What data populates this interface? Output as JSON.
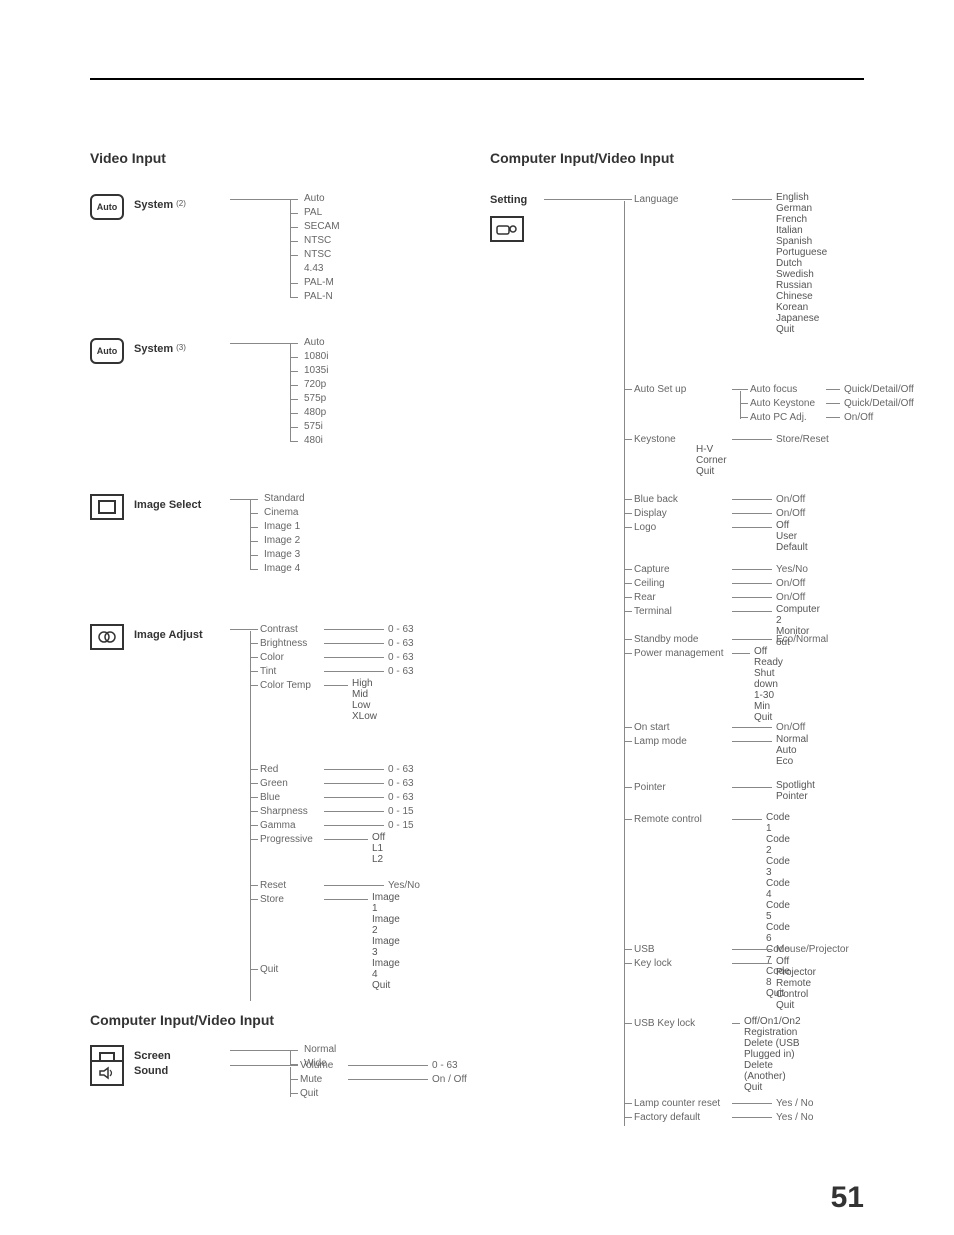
{
  "page_number": "51",
  "video_input": {
    "title": "Video Input",
    "auto_label": "Auto",
    "system2": {
      "label": "System",
      "note": "(2)",
      "items": [
        "Auto",
        "PAL",
        "SECAM",
        "NTSC",
        "NTSC 4.43",
        "PAL-M",
        "PAL-N"
      ]
    },
    "system3": {
      "label": "System",
      "note": "(3)",
      "items": [
        "Auto",
        "1080i",
        "1035i",
        "720p",
        "575p",
        "480p",
        "575i",
        "480i"
      ]
    },
    "image_select": {
      "label": "Image Select",
      "items": [
        "Standard",
        "Cinema",
        "Image 1",
        "Image 2",
        "Image 3",
        "Image 4"
      ]
    },
    "image_adjust": {
      "label": "Image Adjust",
      "pairs1": [
        {
          "k": "Contrast",
          "v": "0 - 63"
        },
        {
          "k": "Brightness",
          "v": "0 - 63"
        },
        {
          "k": "Color",
          "v": "0 - 63"
        },
        {
          "k": "Tint",
          "v": "0 - 63"
        }
      ],
      "color_temp": {
        "k": "Color Temp",
        "items": [
          "High",
          "Mid",
          "Low",
          "XLow"
        ]
      },
      "pairs2": [
        {
          "k": "Red",
          "v": "0 - 63"
        },
        {
          "k": "Green",
          "v": "0 - 63"
        },
        {
          "k": "Blue",
          "v": "0 - 63"
        },
        {
          "k": "Sharpness",
          "v": "0 - 15"
        },
        {
          "k": "Gamma",
          "v": "0 - 15"
        }
      ],
      "progressive": {
        "k": "Progressive",
        "items": [
          "Off",
          "L1",
          "L2"
        ]
      },
      "reset": {
        "k": "Reset",
        "v": "Yes/No"
      },
      "store": {
        "k": "Store",
        "items": [
          "Image 1",
          "Image 2",
          "Image 3",
          "Image 4",
          "Quit"
        ]
      },
      "quit": "Quit"
    },
    "screen": {
      "label": "Screen",
      "items": [
        "Normal",
        "Wide"
      ]
    }
  },
  "sound": {
    "title": "Computer Input/Video Input",
    "label": "Sound",
    "volume": {
      "k": "Volume",
      "v": "0 - 63"
    },
    "mute": {
      "k": "Mute",
      "v": "On / Off"
    },
    "quit": "Quit"
  },
  "setting": {
    "title": "Computer Input/Video Input",
    "label": "Setting",
    "language": {
      "k": "Language",
      "items": [
        "English",
        "German",
        "French",
        "Italian",
        "Spanish",
        "Portuguese",
        "Dutch",
        "Swedish",
        "Russian",
        "Chinese",
        "Korean",
        "Japanese",
        "Quit"
      ]
    },
    "auto_setup": {
      "k": "Auto Set up",
      "rows": [
        {
          "k": "Auto focus",
          "v": "Quick/Detail/Off"
        },
        {
          "k": "Auto Keystone",
          "v": "Quick/Detail/Off"
        },
        {
          "k": "Auto PC Adj.",
          "v": "On/Off"
        }
      ]
    },
    "keystone": {
      "k": "Keystone",
      "right": "Store/Reset",
      "items": [
        "H-V",
        "Corner",
        "Quit"
      ]
    },
    "simple_rows": [
      {
        "k": "Blue back",
        "v": "On/Off"
      },
      {
        "k": "Display",
        "v": "On/Off"
      }
    ],
    "logo": {
      "k": "Logo",
      "items": [
        "Off",
        "User",
        "Default"
      ]
    },
    "simple_rows2": [
      {
        "k": "Capture",
        "v": "Yes/No"
      },
      {
        "k": "Ceiling",
        "v": "On/Off"
      },
      {
        "k": "Rear",
        "v": "On/Off"
      }
    ],
    "terminal": {
      "k": "Terminal",
      "items": [
        "Computer 2",
        "Monitor out"
      ]
    },
    "standby": {
      "k": "Standby mode",
      "v": "Eco/Normal"
    },
    "power_mgmt": {
      "k": "Power management",
      "items": [
        "Off",
        "Ready",
        "Shut down",
        "1-30 Min",
        "Quit"
      ]
    },
    "on_start": {
      "k": "On start",
      "v": "On/Off"
    },
    "lamp_mode": {
      "k": "Lamp mode",
      "items": [
        "Normal",
        "Auto",
        "Eco"
      ]
    },
    "pointer": {
      "k": "Pointer",
      "items": [
        "Spotlight",
        "Pointer"
      ]
    },
    "remote_control": {
      "k": "Remote control",
      "items": [
        "Code 1",
        "Code 2",
        "Code 3",
        "Code 4",
        "Code 5",
        "Code 6",
        "Code 7",
        "Code 8",
        "Quit"
      ]
    },
    "usb": {
      "k": "USB",
      "v": "Mouse/Projector"
    },
    "key_lock": {
      "k": "Key lock",
      "items": [
        "Off",
        "Projector",
        "Remote Control",
        "Quit"
      ]
    },
    "usb_key_lock": {
      "k": "USB Key lock",
      "items": [
        "Off/On1/On2",
        "Registration",
        "Delete (USB Plugged in)",
        "Delete (Another)",
        "Quit"
      ]
    },
    "lamp_counter": {
      "k": "Lamp counter reset",
      "v": "Yes / No"
    },
    "factory_default": {
      "k": "Factory default",
      "v": "Yes / No"
    }
  }
}
